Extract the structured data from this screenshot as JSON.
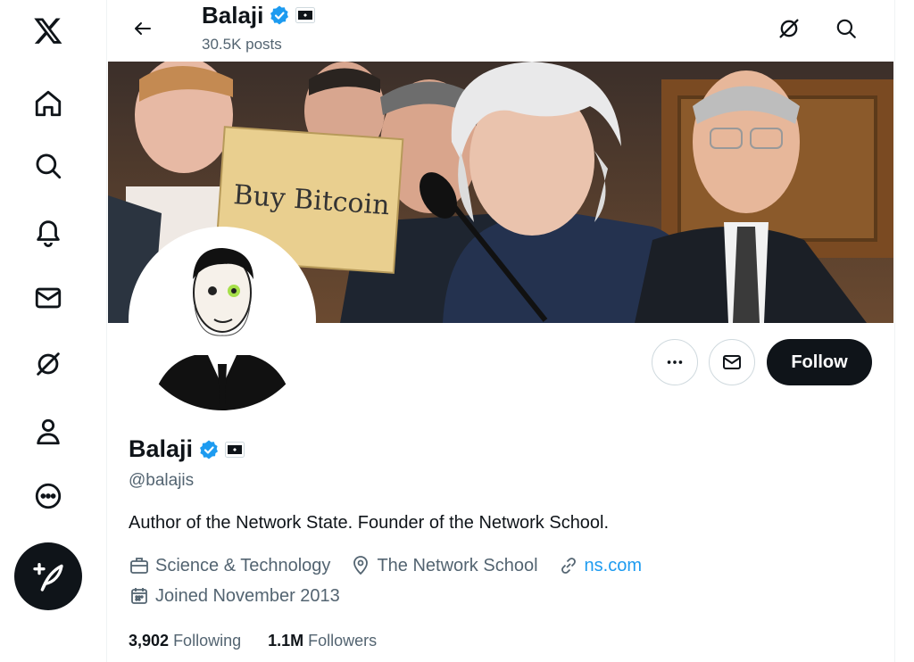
{
  "nav": {
    "items": [
      "x-logo",
      "home",
      "explore",
      "notifications",
      "messages",
      "grok",
      "profile",
      "more"
    ]
  },
  "header": {
    "name": "Balaji",
    "posts": "30.5K posts"
  },
  "profile": {
    "name": "Balaji",
    "handle": "@balajis",
    "bio": "Author of the Network State. Founder of the Network School.",
    "category": "Science & Technology",
    "location": "The Network School",
    "website": "ns.com",
    "joined": "Joined November 2013",
    "following_count": "3,902",
    "following_label": "Following",
    "followers_count": "1.1M",
    "followers_label": "Followers",
    "follow_label": "Follow"
  },
  "banner": {
    "sign_text": "Buy Bitcoin"
  },
  "colors": {
    "accent": "#1d9bf0",
    "text": "#0f1419",
    "muted": "#536471",
    "button_dark": "#0f1419"
  }
}
